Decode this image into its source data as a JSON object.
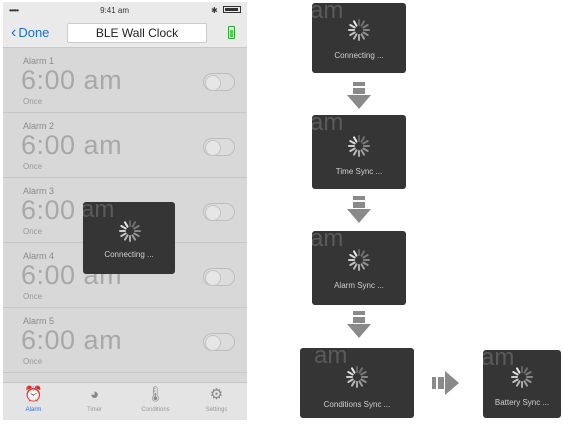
{
  "status_bar": {
    "signal": "•••••",
    "time": "9:41 am",
    "bluetooth": "✱"
  },
  "nav": {
    "back_label": "Done",
    "title": "BLE Wall Clock"
  },
  "alarms": [
    {
      "label": "Alarm 1",
      "time": "6:00 am",
      "repeat": "Once",
      "enabled": false
    },
    {
      "label": "Alarm 2",
      "time": "6:00 am",
      "repeat": "Once",
      "enabled": false
    },
    {
      "label": "Alarm 3",
      "time": "6:00 am",
      "repeat": "Once",
      "enabled": false
    },
    {
      "label": "Alarm 4",
      "time": "6:00 am",
      "repeat": "Once",
      "enabled": false
    },
    {
      "label": "Alarm 5",
      "time": "6:00 am",
      "repeat": "Once",
      "enabled": false
    }
  ],
  "phone_hud": {
    "bg_text": "am",
    "label": "Connecting ..."
  },
  "tabs": [
    {
      "label": "Alarm",
      "icon": "alarm-clock-icon",
      "active": true
    },
    {
      "label": "Timer",
      "icon": "timer-icon",
      "active": false
    },
    {
      "label": "Conditions",
      "icon": "thermometer-drop-icon",
      "active": false
    },
    {
      "label": "Settings",
      "icon": "gear-icon",
      "active": false
    }
  ],
  "sync_sequence": [
    {
      "bg_text": "am",
      "label": "Connecting ..."
    },
    {
      "bg_text": "am",
      "label": "Time Sync ..."
    },
    {
      "bg_text": "am",
      "label": "Alarm Sync ..."
    },
    {
      "bg_text": "am",
      "label": "Conditions Sync ..."
    },
    {
      "bg_text": "am",
      "label": "Battery Sync ..."
    }
  ],
  "colors": {
    "accent": "#2a6fd6",
    "hud_bg": "#353535",
    "arrow": "#8a8a8a",
    "battery_green": "#55cc55"
  }
}
